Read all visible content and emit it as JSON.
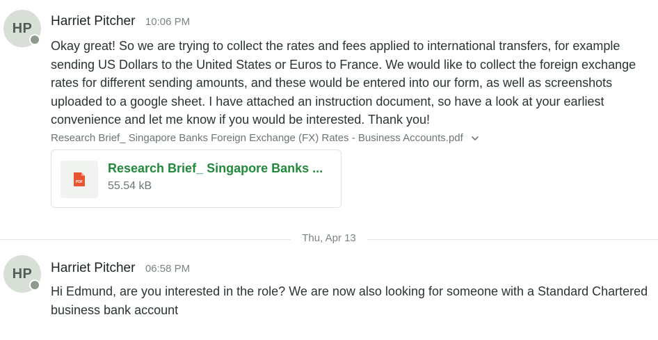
{
  "messages": [
    {
      "avatar_initials": "HP",
      "sender": "Harriet Pitcher",
      "time": "10:06 PM",
      "text": "Okay great! So we are trying to collect the rates and fees applied to international transfers, for example sending US Dollars to the United States or Euros to France. We would like to collect the foreign exchange rates for different sending amounts, and these would be entered into our form, as well as screenshots uploaded to a google sheet. I have attached an instruction document, so have a look at your earliest convenience and let me know if you would be interested. Thank you!",
      "attachment": {
        "filename": "Research Brief_ Singapore Banks Foreign Exchange (FX) Rates - Business Accounts.pdf",
        "card_title": "Research Brief_ Singapore Banks ...",
        "size": "55.54 kB",
        "icon": "pdf-icon",
        "icon_label": "PDF"
      }
    },
    {
      "avatar_initials": "HP",
      "sender": "Harriet Pitcher",
      "time": "06:58 PM",
      "text": "Hi Edmund, are you interested in the role? We are now also looking for someone with a Standard Chartered business bank account"
    }
  ],
  "date_divider": "Thu, Apr 13",
  "colors": {
    "link_green": "#218a3a",
    "pdf_red": "#e8552e",
    "avatar_bg": "#d8dfd7",
    "presence": "#8e9a90"
  }
}
